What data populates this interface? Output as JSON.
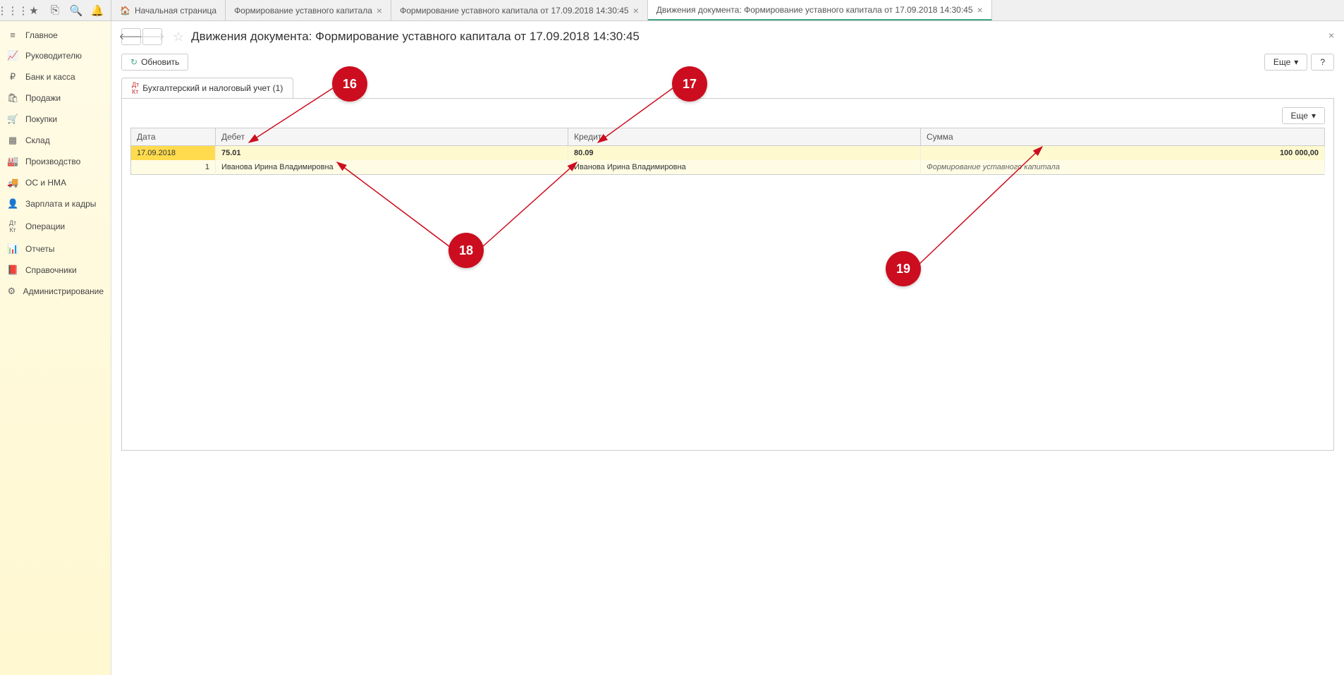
{
  "toolbar": {
    "icons": [
      "apps",
      "star",
      "copy",
      "search",
      "bell"
    ]
  },
  "tabs": [
    {
      "label": "Начальная страница",
      "icon": "home",
      "hasClose": false
    },
    {
      "label": "Формирование уставного капитала",
      "hasClose": true
    },
    {
      "label": "Формирование уставного капитала от 17.09.2018 14:30:45",
      "hasClose": true
    },
    {
      "label": "Движения документа: Формирование уставного капитала от 17.09.2018 14:30:45",
      "hasClose": true,
      "active": true
    }
  ],
  "sidebar": {
    "items": [
      {
        "icon": "≡",
        "label": "Главное"
      },
      {
        "icon": "↗",
        "label": "Руководителю"
      },
      {
        "icon": "₽",
        "label": "Банк и касса"
      },
      {
        "icon": "🛍",
        "label": "Продажи"
      },
      {
        "icon": "🛒",
        "label": "Покупки"
      },
      {
        "icon": "▦",
        "label": "Склад"
      },
      {
        "icon": "🏭",
        "label": "Производство"
      },
      {
        "icon": "🚚",
        "label": "ОС и НМА"
      },
      {
        "icon": "👤",
        "label": "Зарплата и кадры"
      },
      {
        "icon": "Дт",
        "label": "Операции"
      },
      {
        "icon": "📊",
        "label": "Отчеты"
      },
      {
        "icon": "📕",
        "label": "Справочники"
      },
      {
        "icon": "⚙",
        "label": "Администрирование"
      }
    ]
  },
  "page": {
    "title": "Движения документа: Формирование уставного капитала от 17.09.2018 14:30:45"
  },
  "buttons": {
    "refresh": "Обновить",
    "more": "Еще",
    "help": "?"
  },
  "subTab": {
    "label": "Бухгалтерский и налоговый учет (1)"
  },
  "table": {
    "headers": {
      "date": "Дата",
      "debit": "Дебет",
      "credit": "Кредит",
      "sum": "Сумма"
    },
    "row1": {
      "date": "17.09.2018",
      "debit": "75.01",
      "credit": "80.09",
      "sum": "100 000,00"
    },
    "row2": {
      "num": "1",
      "debit": "Иванова Ирина Владимировна",
      "credit": "Иванова Ирина Владимировна",
      "desc": "Формирование уставного капитала"
    }
  },
  "annotations": {
    "a16": "16",
    "a17": "17",
    "a18": "18",
    "a19": "19"
  }
}
